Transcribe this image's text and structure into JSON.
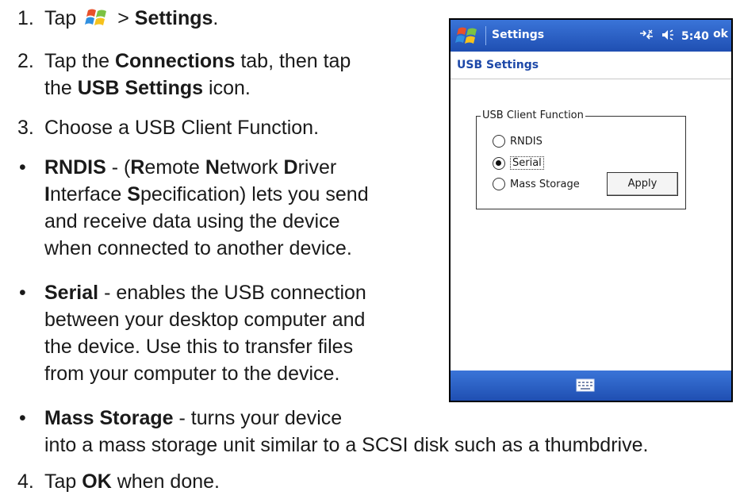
{
  "colors": {
    "title_bar": "#2a62c9",
    "subtitle_text": "#1d48a8",
    "page_bg": "#ffffff"
  },
  "steps": {
    "s1": {
      "num": "1.",
      "pre": "Tap",
      "icon": "windows-start-icon",
      "gt": ">",
      "bold": "Settings",
      "post": "."
    },
    "s2": {
      "num": "2.",
      "pre": "Tap the",
      "bold1": "Connections",
      "mid": "tab, then tap",
      "l2pre": "the",
      "bold2": "USB Settings",
      "l2post": "icon."
    },
    "s3": {
      "num": "3.",
      "text": "Choose a USB Client Function."
    },
    "s4": {
      "num": "4.",
      "pre": "Tap",
      "bold": "OK",
      "post": "when done."
    }
  },
  "bullets": {
    "symbol": "•",
    "rndis": {
      "name": "RNDIS",
      "dash": "- (",
      "R": "R",
      "emote": "emote",
      "N": "N",
      "etwork": "etwork",
      "D": "D",
      "river": "river",
      "I": "I",
      "nterface": "nterface",
      "S": "S",
      "pec": "pecification) lets you send",
      "l3": "and receive data using the device",
      "l4": "when connected to another device."
    },
    "serial": {
      "name": "Serial",
      "l1": "- enables the USB connection",
      "l2": "between your desktop computer and",
      "l3": "the device.  Use this to transfer files",
      "l4": "from your computer to the device."
    },
    "mass": {
      "name": "Mass Storage",
      "l1": "- turns your device",
      "l2": "into a mass storage unit similar to a SCSI disk such as a thumbdrive."
    }
  },
  "device": {
    "title": "Settings",
    "time": "5:40",
    "ok": "ok",
    "page_title": "USB Settings",
    "group_label": "USB Client Function",
    "options": [
      {
        "label": "RNDIS",
        "selected": false
      },
      {
        "label": "Serial",
        "selected": true
      },
      {
        "label": "Mass Storage",
        "selected": false
      }
    ],
    "apply_label": "Apply",
    "icons": [
      "windows-start-icon",
      "connectivity-icon",
      "volume-icon",
      "keyboard-icon"
    ]
  }
}
